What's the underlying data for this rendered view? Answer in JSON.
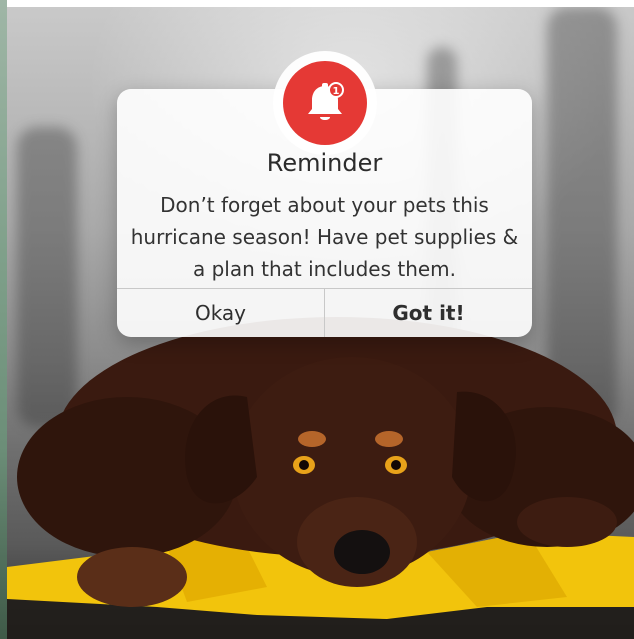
{
  "dialog": {
    "title": "Reminder",
    "message": "Don’t forget about your pets this hurricane season! Have pet supplies & a plan that includes them.",
    "buttons": {
      "okay": "Okay",
      "got_it": "Got it!"
    },
    "icon": "bell-icon",
    "badge_count": "1"
  },
  "colors": {
    "accent": "#e53935",
    "tarp": "#f2c40c",
    "dog": "#3a1a10"
  }
}
